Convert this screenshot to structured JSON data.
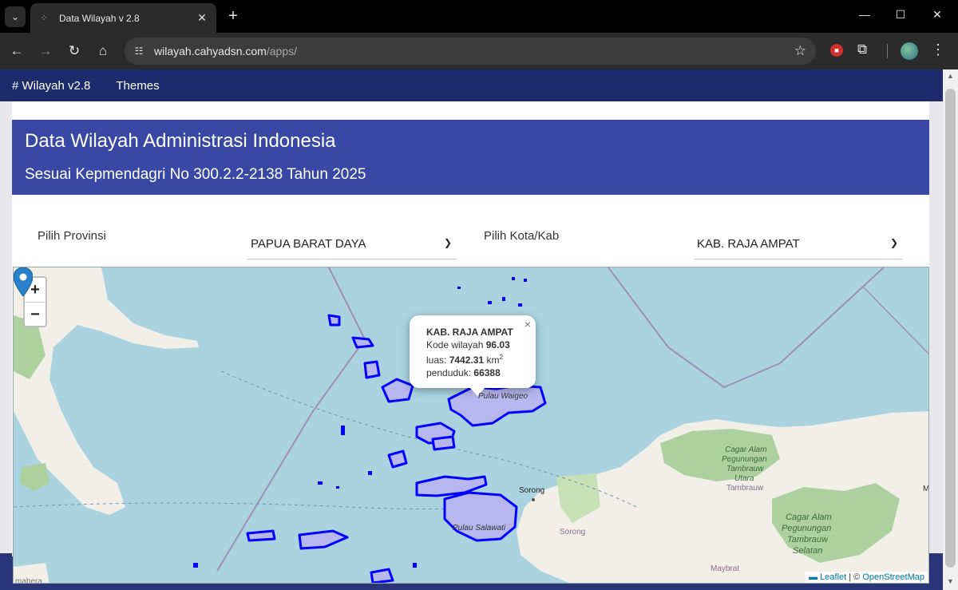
{
  "browser": {
    "tab_title": "Data Wilayah v 2.8",
    "new_tab_label": "+",
    "url_host": "wilayah.cahyadsn.com",
    "url_path": "/apps/"
  },
  "navbar": {
    "brand": "# Wilayah v2.8",
    "themes": "Themes"
  },
  "header": {
    "title": "Data Wilayah Administrasi Indonesia",
    "subtitle": "Sesuai Kepmendagri No 300.2.2-2138 Tahun 2025"
  },
  "form": {
    "province_label": "Pilih Provinsi",
    "province_value": "PAPUA BARAT DAYA",
    "city_label": "Pilih Kota/Kab",
    "city_value": "KAB. RAJA AMPAT"
  },
  "map": {
    "zoom_in": "+",
    "zoom_out": "−",
    "popup": {
      "title": "KAB. RAJA AMPAT",
      "kode_label": "Kode wilayah",
      "kode_value": "96.03",
      "luas_label": "luas:",
      "luas_value": "7442.31",
      "luas_unit": "km",
      "luas_sup": "2",
      "penduduk_label": "penduduk:",
      "penduduk_value": "66388",
      "close": "×"
    },
    "labels": {
      "waigeo": "Pulau Waigeo",
      "salawati": "Pulau Salawati",
      "sorong_city": "Sorong",
      "sorong_regency": "Sorong",
      "maybrat": "Maybrat",
      "cagar_utara_1": "Cagar Alam",
      "cagar_utara_2": "Pegunungan",
      "cagar_utara_3": "Tambrauw",
      "cagar_utara_4": "Utara",
      "tambrauw": "Tambrauw",
      "cagar_selatan_1": "Cagar Alam",
      "cagar_selatan_2": "Pegunungan",
      "cagar_selatan_3": "Tambrauw",
      "cagar_selatan_4": "Selatan",
      "edge_m": "M",
      "halmahera": "mahera"
    },
    "attribution": {
      "leaflet": "Leaflet",
      "separator": " | © ",
      "osm": "OpenStreetMap"
    }
  },
  "colors": {
    "navbar": "#1d2a6b",
    "header": "#3848a4",
    "water": "#aad3df",
    "region_stroke": "#0000ff",
    "region_fill": "#b7b7f0",
    "land": "#f2efe9",
    "forest": "#add19e",
    "marker": "#2a81cb"
  }
}
